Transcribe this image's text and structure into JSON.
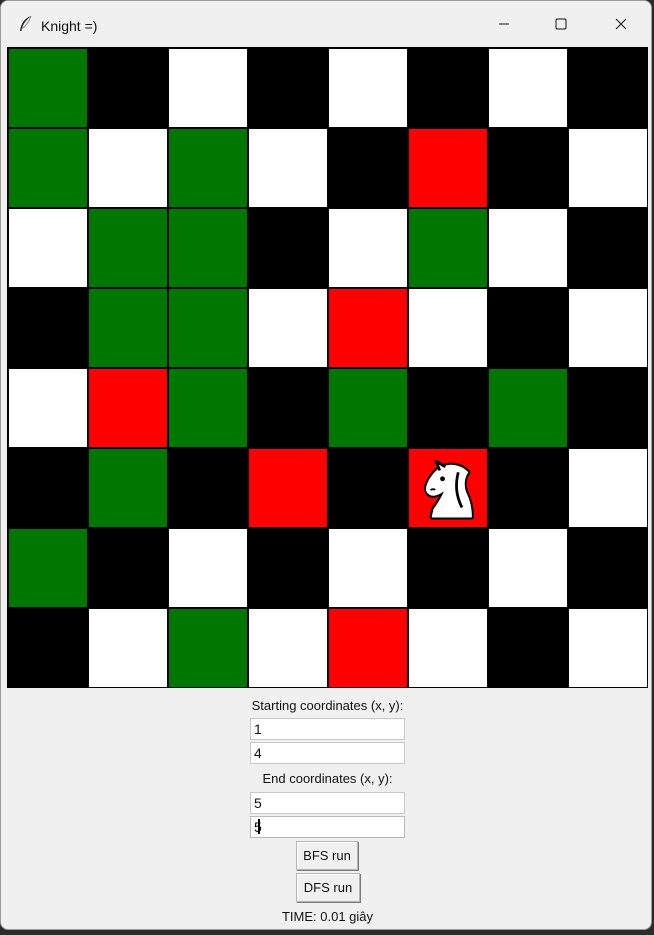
{
  "window": {
    "title": "Knight =)"
  },
  "board": {
    "rows": [
      [
        "green",
        "black",
        "white",
        "black",
        "white",
        "black",
        "white",
        "black"
      ],
      [
        "green",
        "white",
        "green",
        "white",
        "black",
        "red",
        "black",
        "white"
      ],
      [
        "white",
        "green",
        "green",
        "black",
        "white",
        "green",
        "white",
        "black"
      ],
      [
        "black",
        "green",
        "green",
        "white",
        "red",
        "white",
        "black",
        "white"
      ],
      [
        "white",
        "red",
        "green",
        "black",
        "green",
        "black",
        "green",
        "black"
      ],
      [
        "black",
        "green",
        "black",
        "red",
        "black",
        "red",
        "black",
        "white"
      ],
      [
        "green",
        "black",
        "white",
        "black",
        "white",
        "black",
        "white",
        "black"
      ],
      [
        "black",
        "white",
        "green",
        "white",
        "red",
        "white",
        "black",
        "white"
      ]
    ],
    "knight_cell": {
      "row": 5,
      "col": 5
    }
  },
  "form": {
    "start_label": "Starting coordinates (x, y):",
    "start_x": "1",
    "start_y": "4",
    "end_label": "End coordinates (x, y):",
    "end_x": "5",
    "end_y": "5",
    "bfs_label": "BFS run",
    "dfs_label": "DFS run",
    "time_label": "TIME: 0.01 giây"
  },
  "colors": {
    "green": "#007700",
    "red": "#ff0000",
    "black": "#000000",
    "white": "#ffffff"
  }
}
